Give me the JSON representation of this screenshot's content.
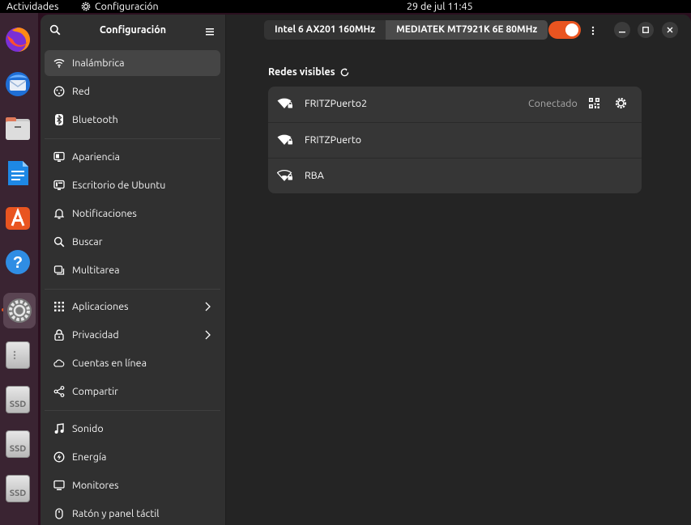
{
  "topbar": {
    "activities": "Actividades",
    "app_name": "Configuración",
    "clock": "29 de jul  11:45"
  },
  "dock": {
    "items": [
      {
        "name": "firefox-icon"
      },
      {
        "name": "thunderbird-icon"
      },
      {
        "name": "files-icon"
      },
      {
        "name": "writer-icon"
      },
      {
        "name": "app-center-icon"
      },
      {
        "name": "help-icon"
      },
      {
        "name": "settings-icon"
      },
      {
        "name": "disk-icon"
      },
      {
        "name": "ssd-disk-icon",
        "label": "SSD"
      },
      {
        "name": "ssd-disk-icon",
        "label": "SSD"
      },
      {
        "name": "ssd-disk-icon",
        "label": "SSD"
      }
    ]
  },
  "sidebar": {
    "title": "Configuración",
    "items": [
      {
        "label": "Inalámbrica",
        "icon": "wifi-icon",
        "selected": true
      },
      {
        "label": "Red",
        "icon": "network-icon"
      },
      {
        "label": "Bluetooth",
        "icon": "bluetooth-icon"
      },
      {
        "label": "Apariencia",
        "icon": "appearance-icon"
      },
      {
        "label": "Escritorio de Ubuntu",
        "icon": "desktop-icon"
      },
      {
        "label": "Notificaciones",
        "icon": "bell-icon"
      },
      {
        "label": "Buscar",
        "icon": "search-icon"
      },
      {
        "label": "Multitarea",
        "icon": "multitask-icon"
      },
      {
        "label": "Aplicaciones",
        "icon": "apps-grid-icon",
        "chevron": true
      },
      {
        "label": "Privacidad",
        "icon": "lock-icon",
        "chevron": true
      },
      {
        "label": "Cuentas en línea",
        "icon": "cloud-icon"
      },
      {
        "label": "Compartir",
        "icon": "share-icon"
      },
      {
        "label": "Sonido",
        "icon": "music-note-icon"
      },
      {
        "label": "Energía",
        "icon": "power-icon"
      },
      {
        "label": "Monitores",
        "icon": "monitor-icon"
      },
      {
        "label": "Ratón y panel táctil",
        "icon": "mouse-icon"
      }
    ]
  },
  "header": {
    "tabs": [
      {
        "label": "Intel 6 AX201 160MHz"
      },
      {
        "label": "MEDIATEK MT7921K 6E 80MHz",
        "active": true
      }
    ],
    "wifi_enabled": true
  },
  "main": {
    "section_title": "Redes visibles",
    "networks": [
      {
        "name": "FRITZPuerto2",
        "status": "Conectado",
        "secured": true,
        "signal": "full"
      },
      {
        "name": "FRITZPuerto",
        "status": "",
        "secured": true,
        "signal": "full"
      },
      {
        "name": "RBA",
        "status": "",
        "secured": true,
        "signal": "weak"
      }
    ]
  },
  "colors": {
    "accent": "#e95420",
    "window_bg": "#242424",
    "sidebar_bg": "#303030",
    "list_bg": "#363636"
  }
}
